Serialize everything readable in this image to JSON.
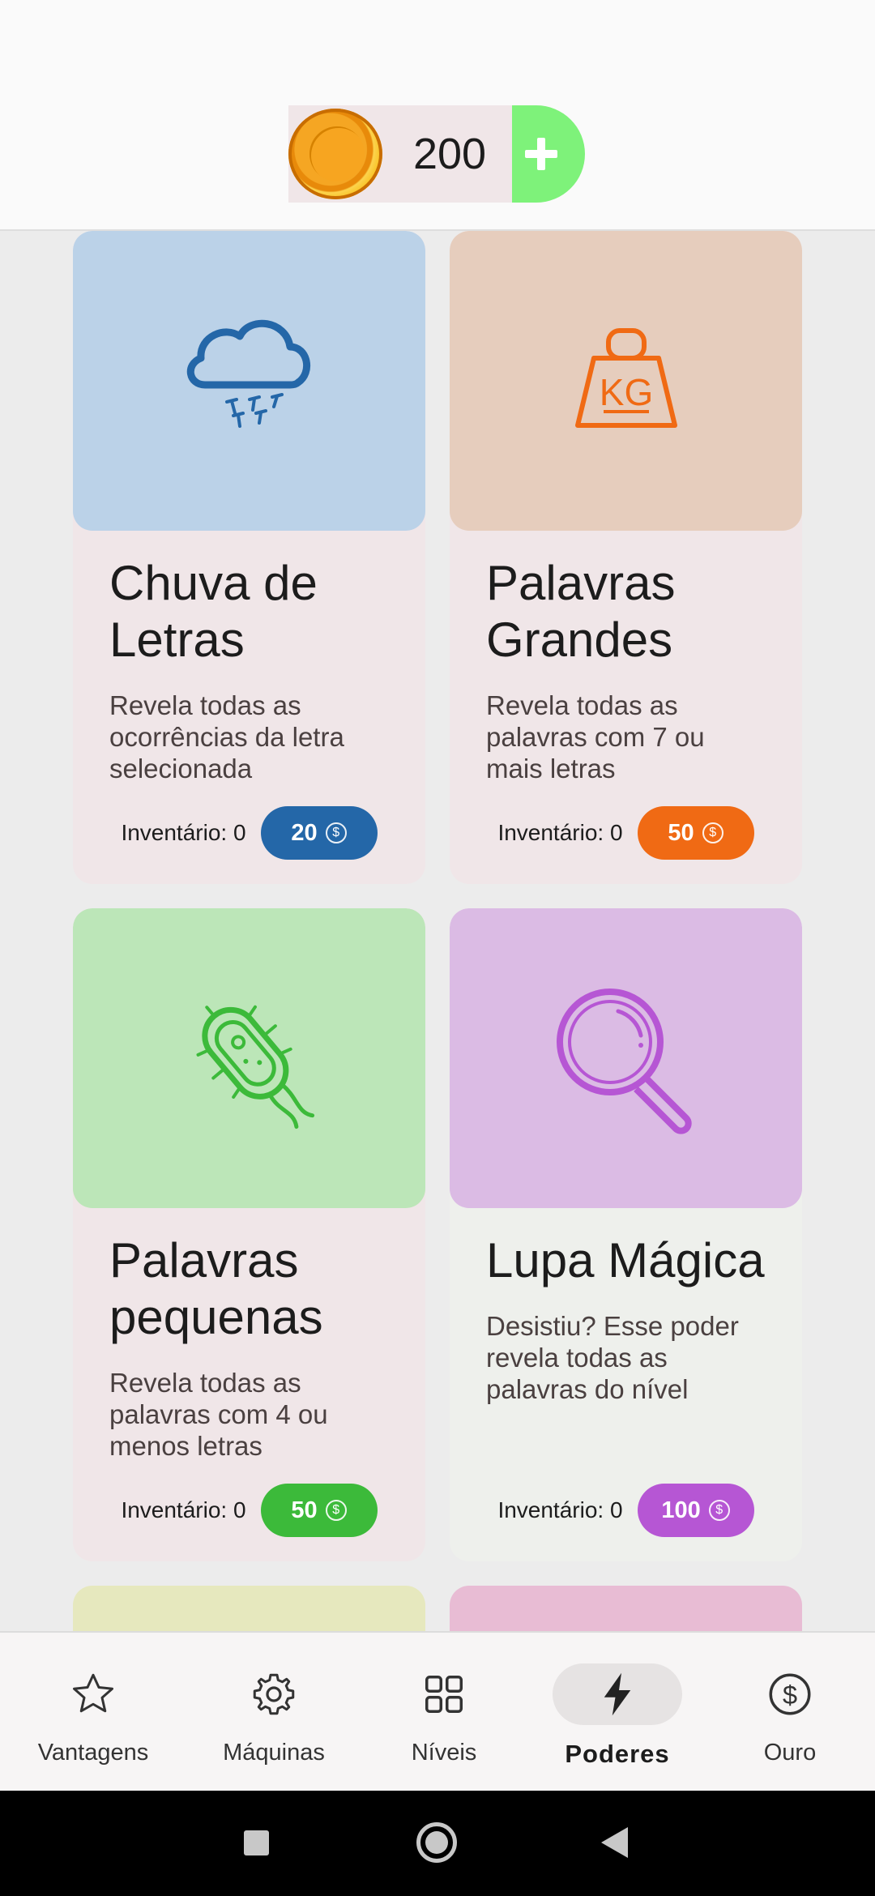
{
  "header": {
    "coins": "200",
    "coin_icon": "gold-coin-icon",
    "add_icon": "plus-icon"
  },
  "powers": [
    {
      "title": "Chuva de Letras",
      "description": "Revela todas as ocorrências da letra selecionada",
      "inventory": "Inventário: 0",
      "price": "20",
      "icon": "letter-rain-cloud-icon",
      "image_bg": "#bbd2e8",
      "card_bg": "#f0e6e8",
      "accent": "#2467a8"
    },
    {
      "title": "Palavras Grandes",
      "description": "Revela todas as palavras com 7 ou mais letras",
      "inventory": "Inventário: 0",
      "price": "50",
      "icon": "kg-weight-icon",
      "image_bg": "#e6cdbd",
      "card_bg": "#f0e6e8",
      "accent": "#f06a14"
    },
    {
      "title": "Palavras pequenas",
      "description": "Revela todas as palavras com 4 ou menos letras",
      "inventory": "Inventário: 0",
      "price": "50",
      "icon": "bacteria-icon",
      "image_bg": "#bce6b8",
      "card_bg": "#f0e6e8",
      "accent": "#3cba3a"
    },
    {
      "title": "Lupa Mágica",
      "description": "Desistiu? Esse poder revela todas as palavras do nível",
      "inventory": "Inventário: 0",
      "price": "100",
      "icon": "magnifying-glass-icon",
      "image_bg": "#dbbbe4",
      "card_bg": "#eef0ec",
      "accent": "#b656d4"
    }
  ],
  "partial_cards": [
    {
      "image_bg": "#e6e8be"
    },
    {
      "image_bg": "#e8bcd4"
    }
  ],
  "nav": {
    "items": [
      {
        "label": "Vantagens",
        "icon": "star-icon",
        "active": false
      },
      {
        "label": "Máquinas",
        "icon": "gear-icon",
        "active": false
      },
      {
        "label": "Níveis",
        "icon": "grid-icon",
        "active": false
      },
      {
        "label": "Poderes",
        "icon": "lightning-icon",
        "active": true
      },
      {
        "label": "Ouro",
        "icon": "dollar-coin-icon",
        "active": false
      }
    ]
  },
  "system_nav": {
    "recents_icon": "square-recents-icon",
    "home_icon": "circle-home-icon",
    "back_icon": "triangle-back-icon"
  }
}
